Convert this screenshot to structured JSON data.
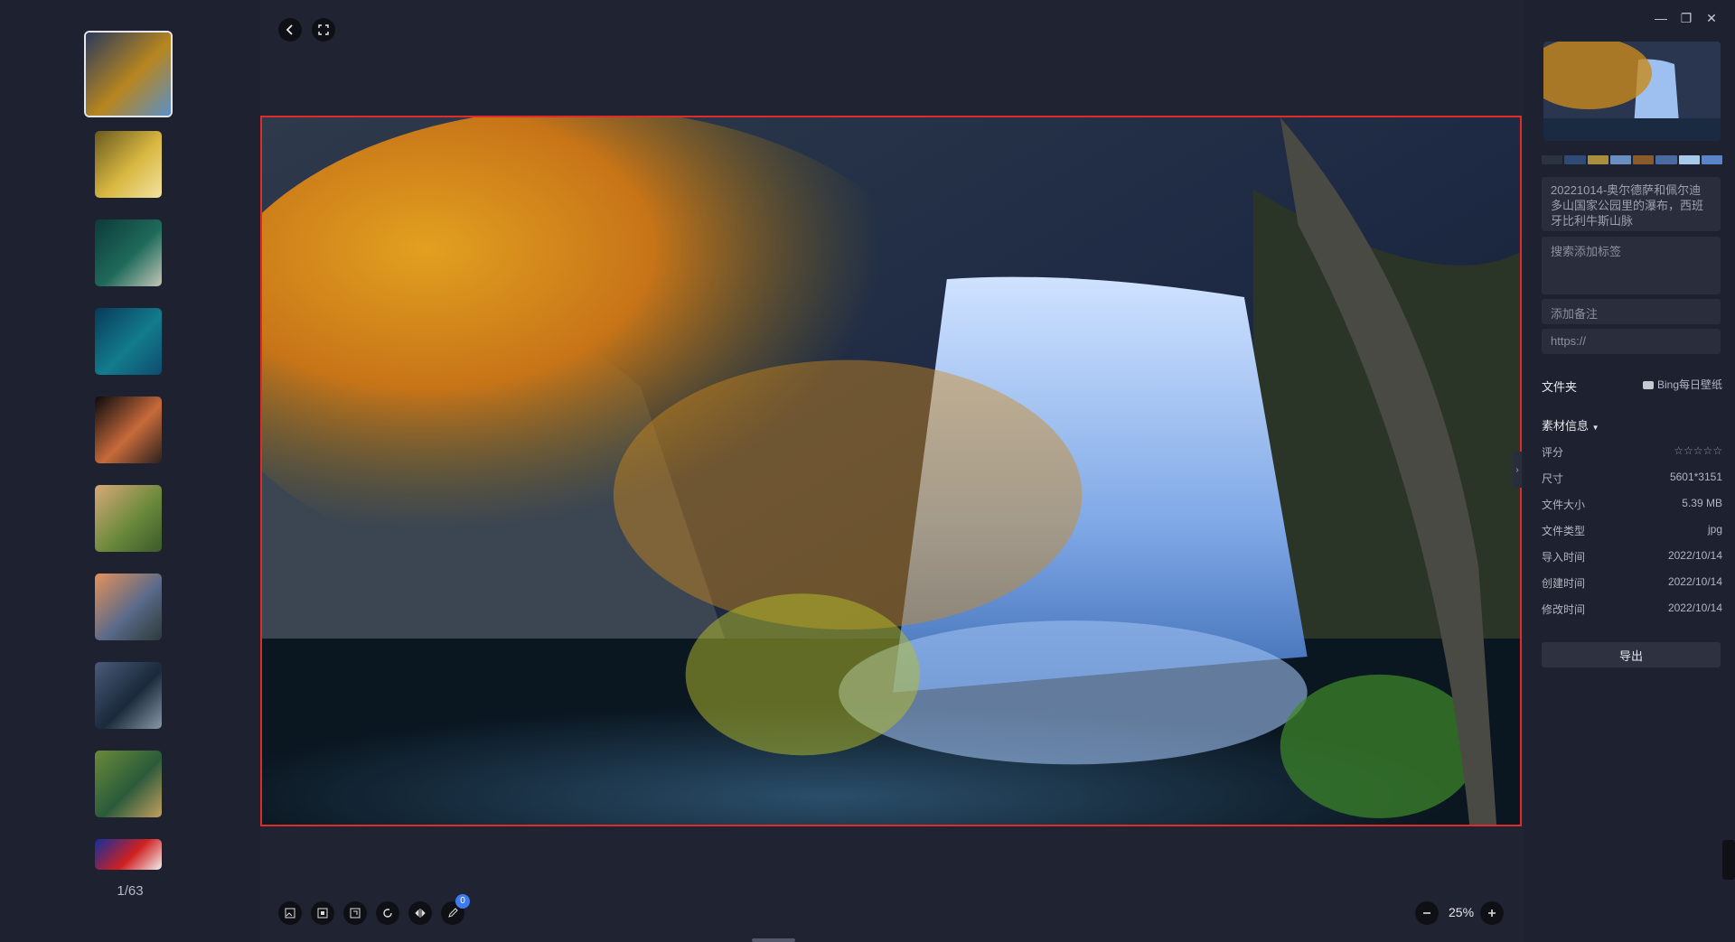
{
  "left_strip": {
    "counter": "1/63",
    "thumbnails": [
      {
        "name": "thumb-waterfall",
        "colors": [
          "#2b3a5a",
          "#b7861f",
          "#5a90c8"
        ]
      },
      {
        "name": "thumb-birds",
        "colors": [
          "#6b5a1f",
          "#d9b842",
          "#f0e2a0"
        ]
      },
      {
        "name": "thumb-aerial-road",
        "colors": [
          "#0c3a3a",
          "#1f6a5a",
          "#c2c6b8"
        ]
      },
      {
        "name": "thumb-ocean",
        "colors": [
          "#083a5a",
          "#137c8c",
          "#0e4b6f"
        ]
      },
      {
        "name": "thumb-octopus",
        "colors": [
          "#0a0a0e",
          "#c76a3a",
          "#2a2220"
        ]
      },
      {
        "name": "thumb-hills",
        "colors": [
          "#d8a878",
          "#6c8a3c",
          "#3a5a2a"
        ]
      },
      {
        "name": "thumb-mountain-sunset",
        "colors": [
          "#e4925a",
          "#5a6a8a",
          "#2d3a3a"
        ]
      },
      {
        "name": "thumb-seals",
        "colors": [
          "#4a5a7a",
          "#1a2a3a",
          "#8898a8"
        ]
      },
      {
        "name": "thumb-kingfisher",
        "colors": [
          "#6a8a3a",
          "#2a5a3a",
          "#c4a060"
        ]
      },
      {
        "name": "thumb-red-items",
        "colors": [
          "#1030a0",
          "#d02020",
          "#f0f0f0"
        ]
      }
    ]
  },
  "viewer": {
    "zoom": "25%",
    "annotation_count": "0",
    "icons": [
      "back-icon",
      "fullscreen-icon",
      "image-icon",
      "fit-icon",
      "actual-size-icon",
      "rotate-icon",
      "flip-icon",
      "annotate-icon",
      "zoom-out-icon",
      "zoom-in-icon"
    ]
  },
  "right_panel": {
    "title": "20221014-奥尔德萨和佩尔迪多山国家公园里的瀑布，西班牙比利牛斯山脉",
    "tags_placeholder": "搜索添加标签",
    "note_placeholder": "添加备注",
    "url_placeholder": "https://",
    "folder_label": "文件夹",
    "folder_value": "Bing每日壁纸",
    "info_header": "素材信息",
    "info": [
      {
        "k": "评分",
        "v": "☆☆☆☆☆"
      },
      {
        "k": "尺寸",
        "v": "5601*3151"
      },
      {
        "k": "文件大小",
        "v": "5.39 MB"
      },
      {
        "k": "文件类型",
        "v": "jpg"
      },
      {
        "k": "导入时间",
        "v": "2022/10/14"
      },
      {
        "k": "创建时间",
        "v": "2022/10/14"
      },
      {
        "k": "修改时间",
        "v": "2022/10/14"
      }
    ],
    "export_label": "导出",
    "swatches": [
      "#2b3340",
      "#2f4a75",
      "#a98e3e",
      "#6a8ec0",
      "#8a5a2a",
      "#4a6aa0",
      "#a9c9ea",
      "#5a84c8"
    ]
  }
}
